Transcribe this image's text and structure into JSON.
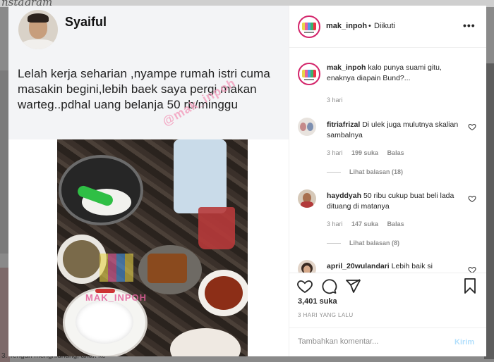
{
  "background": {
    "logo": "nstagram",
    "bottom_text": "3. Tengah menghidnung, anak ke"
  },
  "post": {
    "tweet": {
      "author": "Syaiful",
      "text": "Lelah kerja seharian ,nyampe rumah istri cuma masakin begini,lebih baek saya pergi makan warteg..pdhal uang belanja 50 rb/minggu",
      "watermark": "@mak_inpoh"
    },
    "photo_watermark": "MAK_INPOH"
  },
  "header": {
    "username": "mak_inpoh",
    "separator": "•",
    "follow_status": "Diikuti",
    "more_icon": "more-horizontal-icon"
  },
  "caption": {
    "username": "mak_inpoh",
    "text": "kalo punya suami gitu, enaknya diapain Bund?...",
    "time": "3 hari"
  },
  "comments": [
    {
      "username": "fitriafrizal",
      "text": "Di ulek juga mulutnya skalian sambalnya",
      "time": "3 hari",
      "likes": "199 suka",
      "reply": "Balas",
      "view_replies": "Lihat balasan (18)"
    },
    {
      "username": "hayddyah",
      "text": "50 ribu cukup buat beli lada dituang di matanya",
      "time": "3 hari",
      "likes": "147 suka",
      "reply": "Balas",
      "view_replies": "Lihat balasan (8)"
    },
    {
      "username": "april_20wulandari",
      "text": "Lebih baik si"
    }
  ],
  "actions": {
    "likes": "3,401 suka",
    "timestamp": "3 HARI YANG LALU",
    "icons": [
      "heart-icon",
      "comment-icon",
      "share-icon",
      "bookmark-icon"
    ]
  },
  "add_comment": {
    "placeholder": "Tambahkan komentar...",
    "post_label": "Kirim"
  },
  "colors": {
    "story_ring": "#d3246a",
    "post_button": "#b2dffc",
    "meta": "#8e8e8e"
  }
}
